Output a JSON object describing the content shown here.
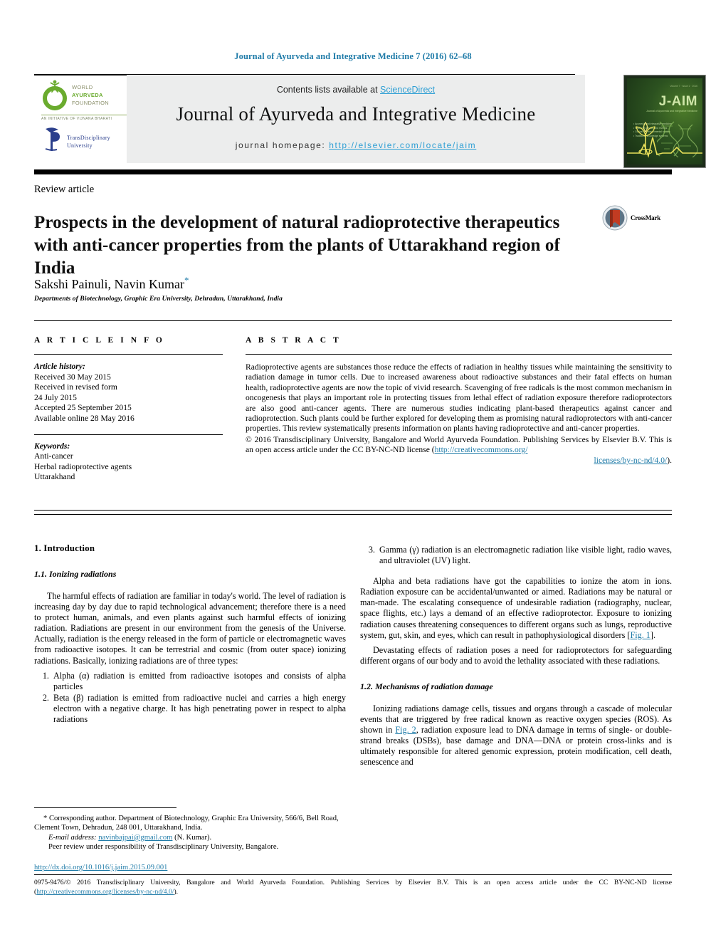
{
  "running_head": "Journal of Ayurveda and Integrative Medicine 7 (2016) 62–68",
  "masthead": {
    "contents_prefix": "Contents lists available at ",
    "sciencedirect": "ScienceDirect",
    "journal_title": "Journal of Ayurveda and Integrative Medicine",
    "homepage_label": "journal homepage: ",
    "homepage_url": "http://elsevier.com/locate/jaim",
    "waf_logo": {
      "line1": "WORLD",
      "line2": "AYURVEDA",
      "line3": "FOUNDATION",
      "tagline": "AN INITIATIVE OF VIJNANA BHARATI"
    },
    "tdu_logo": {
      "line1": "TransDisciplinary",
      "line2": "University"
    },
    "cover": {
      "title": "J-AIM",
      "subtitle": "Journal of Ayurveda and Integrative Medicine",
      "top_bar": "Volume 7 · Issue 1 · 2016",
      "bullets": "• Ayurveda and integrative medicine\n• Research articles and reviews\n• Clinical and experimental studies\n• Traditional knowledge systems"
    }
  },
  "article": {
    "kicker": "Review article",
    "title": "Prospects in the development of natural radioprotective therapeutics with anti-cancer properties from the plants of Uttarakhand region of India",
    "authors": "Sakshi Painuli, Navin Kumar",
    "corresponding_marker": "*",
    "affiliation": "Departments of Biotechnology, Graphic Era University, Dehradun, Uttarakhand, India",
    "crossmark_label": "CrossMark"
  },
  "article_info": {
    "heading": "A R T I C L E   I N F O",
    "history_label": "Article history:",
    "history": [
      "Received 30 May 2015",
      "Received in revised form",
      "24 July 2015",
      "Accepted 25 September 2015",
      "Available online 28 May 2016"
    ],
    "keywords_label": "Keywords:",
    "keywords": [
      "Anti-cancer",
      "Herbal radioprotective agents",
      "Uttarakhand"
    ]
  },
  "abstract": {
    "heading": "A B S T R A C T",
    "body": "Radioprotective agents are substances those reduce the effects of radiation in healthy tissues while maintaining the sensitivity to radiation damage in tumor cells. Due to increased awareness about radioactive substances and their fatal effects on human health, radioprotective agents are now the topic of vivid research. Scavenging of free radicals is the most common mechanism in oncogenesis that plays an important role in protecting tissues from lethal effect of radiation exposure therefore radioprotectors are also good anti-cancer agents. There are numerous studies indicating plant-based therapeutics against cancer and radioprotection. Such plants could be further explored for developing them as promising natural radioprotectors with anti-cancer properties. This review systematically presents information on plants having radioprotective and anti-cancer properties.",
    "copyright_pre": "© 2016 Transdisciplinary University, Bangalore and World Ayurveda Foundation. Publishing Services by Elsevier B.V. This is an open access article under the CC BY-NC-ND license (",
    "copyright_link1": "http://creativecommons.org/",
    "copyright_link2": "licenses/by-nc-nd/4.0/",
    "copyright_post": ")."
  },
  "left_column": {
    "section_number_title": "1.  Introduction",
    "subsection_title": "1.1.  Ionizing radiations",
    "paragraph1": "The harmful effects of radiation are familiar in today's world. The level of radiation is increasing day by day due to rapid technological advancement; therefore there is a need to protect human, animals, and even plants against such harmful effects of ionizing radiation. Radiations are present in our environment from the genesis of the Universe. Actually, radiation is the energy released in the form of particle or electromagnetic waves from radioactive isotopes. It can be terrestrial and cosmic (from outer space) ionizing radiations. Basically, ionizing radiations are of three types:",
    "list": [
      "Alpha (α) radiation is emitted from radioactive isotopes and consists of alpha particles",
      "Beta (β) radiation is emitted from radioactive nuclei and carries a high energy electron with a negative charge. It has high penetrating power in respect to alpha radiations"
    ]
  },
  "right_column": {
    "list_item3": "Gamma (γ) radiation is an electromagnetic radiation like visible light, radio waves, and ultraviolet (UV) light.",
    "paragraph1_pre": "Alpha and beta radiations have got the capabilities to ionize the atom in ions. Radiation exposure can be accidental/unwanted or aimed. Radiations may be natural or man-made. The escalating consequence of undesirable radiation (radiography, nuclear, space flights, etc.) lays a demand of an effective radioprotector. Exposure to ionizing radiation causes threatening consequences to different organs such as lungs, reproductive system, gut, skin, and eyes, which can result in pathophysiological disorders [",
    "fig1_link": "Fig. 1",
    "paragraph1_post": "].",
    "paragraph2": "Devastating effects of radiation poses a need for radioprotectors for safeguarding different organs of our body and to avoid the lethality associated with these radiations.",
    "subsection_title": "1.2.  Mechanisms of radiation damage",
    "paragraph3_pre": "Ionizing radiations damage cells, tissues and organs through a cascade of molecular events that are triggered by free radical known as reactive oxygen species (ROS). As shown in ",
    "fig2_link": "Fig. 2",
    "paragraph3_post": ", radiation exposure lead to DNA damage in terms of single- or double-strand breaks (DSBs), base damage and DNA—DNA or protein cross-links and is ultimately responsible for altered genomic expression, protein modification, cell death, senescence and"
  },
  "footnote": {
    "corresponding": "* Corresponding author. Department of Biotechnology, Graphic Era University, 566/6, Bell Road, Clement Town, Dehradun, 248 001, Uttarakhand, India.",
    "email_label": "E-mail address: ",
    "email": "navinbajpai@gmail.com",
    "email_suffix": " (N. Kumar).",
    "peer_review": "Peer review under responsibility of Transdisciplinary University, Bangalore."
  },
  "bottom": {
    "doi": "http://dx.doi.org/10.1016/j.jaim.2015.09.001",
    "copyright_pre": "0975-9476/© 2016 Transdisciplinary University, Bangalore and World Ayurveda Foundation. Publishing Services by Elsevier B.V. This is an open access article under the CC BY-NC-ND license (",
    "copyright_link": "http://creativecommons.org/licenses/by-nc-nd/4.0/",
    "copyright_post": ")."
  },
  "colors": {
    "link": "#1f7ba8",
    "sciencedirect": "#2e9fd4",
    "waf_green": "#6aab2e",
    "tdu_blue": "#2b3f8c",
    "crossmark_red": "#c23b22"
  }
}
